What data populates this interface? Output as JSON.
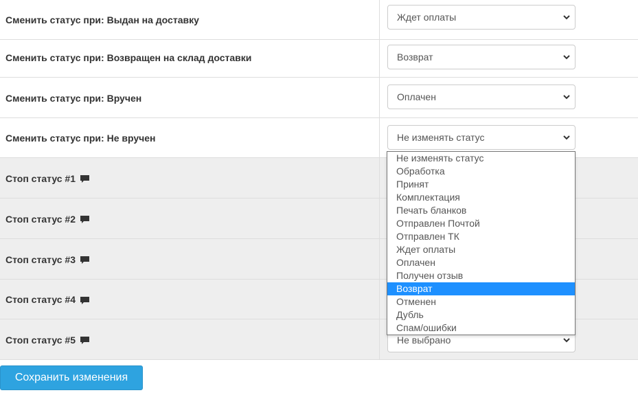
{
  "rows": [
    {
      "label": "Сменить статус при: Выдан на доставку",
      "value": "Ждет оплаты"
    },
    {
      "label": "Сменить статус при: Возвращен на склад доставки",
      "value": "Возврат"
    },
    {
      "label": "Сменить статус при: Вручен",
      "value": "Оплачен"
    },
    {
      "label": "Сменить статус при: Не вручен",
      "value": "Не изменять статус"
    },
    {
      "label": "Стоп статус #1",
      "value": ""
    },
    {
      "label": "Стоп статус #2",
      "value": ""
    },
    {
      "label": "Стоп статус #3",
      "value": ""
    },
    {
      "label": "Стоп статус #4",
      "value": ""
    },
    {
      "label": "Стоп статус #5",
      "value": "Не выбрано"
    }
  ],
  "dropdown": {
    "options": [
      "Не изменять статус",
      "Обработка",
      "Принят",
      "Комплектация",
      "Печать бланков",
      "Отправлен Почтой",
      "Отправлен ТК",
      "Ждет оплаты",
      "Оплачен",
      "Получен отзыв",
      "Возврат",
      "Отменен",
      "Дубль",
      "Спам/ошибки"
    ],
    "highlighted": "Возврат"
  },
  "save_button": {
    "label": "Сохранить изменения"
  },
  "colors": {
    "accent": "#2ea3e0",
    "highlight": "#1e90ff",
    "shaded_row": "#eeeeee",
    "border": "#dddddd"
  },
  "icons": {
    "comment": "comment-icon",
    "chevron": "chevron-down-icon"
  }
}
